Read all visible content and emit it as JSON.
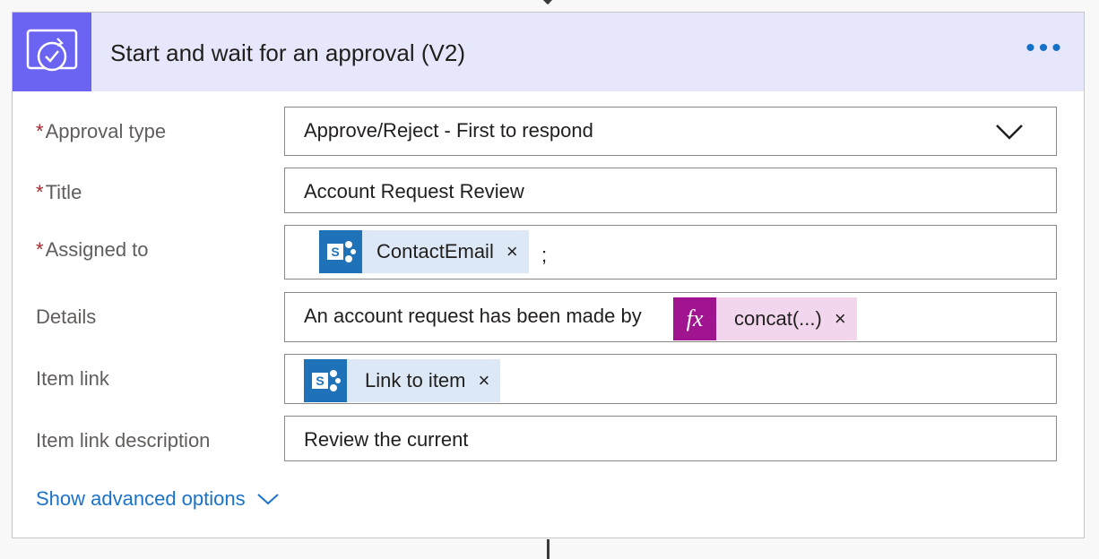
{
  "card": {
    "title": "Start and wait for an approval (V2)",
    "header_icon": "approval-icon",
    "more_label": "•••",
    "accent": "#6b64f2"
  },
  "fields": {
    "approval_type": {
      "label": "Approval type",
      "required": "*",
      "value": "Approve/Reject - First to respond"
    },
    "title": {
      "label": "Title",
      "required": "*",
      "value": "Account Request Review"
    },
    "assigned_to": {
      "label": "Assigned to",
      "required": "*",
      "token": "ContactEmail",
      "suffix": ";"
    },
    "details": {
      "label": "Details",
      "value": "An account request has been made by",
      "token_icon": "fx",
      "token": "concat(...)"
    },
    "item_link": {
      "label": "Item link",
      "token": "Link to item"
    },
    "item_link_description": {
      "label": "Item link description",
      "value": "Review the current"
    }
  },
  "token_remove": "×",
  "advanced_options": "Show advanced options"
}
